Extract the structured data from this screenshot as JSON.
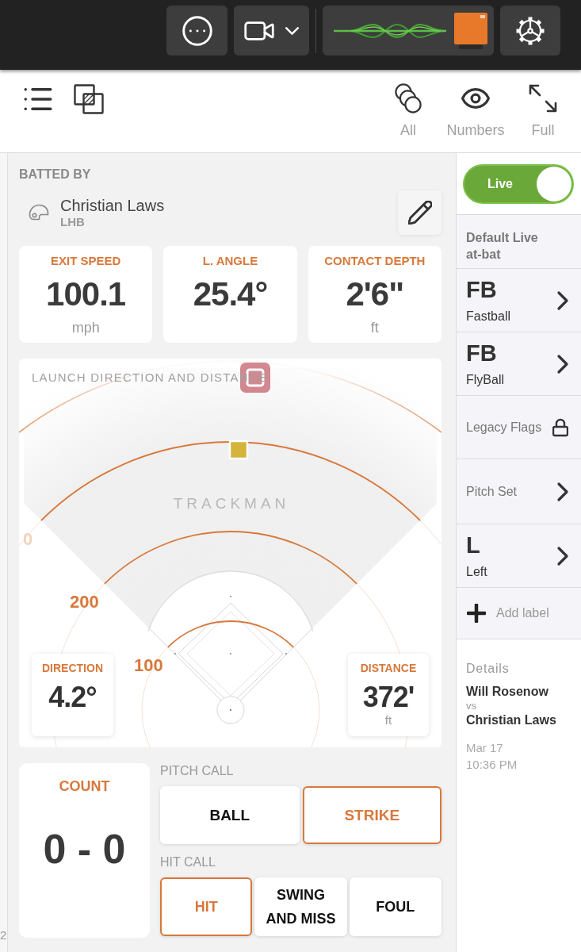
{
  "toolbar": {
    "view_options": [
      {
        "kind": "all",
        "label": "All"
      },
      {
        "kind": "numbers",
        "label": "Numbers"
      },
      {
        "kind": "full",
        "label": "Full"
      }
    ]
  },
  "batted_by": {
    "label": "BATTED BY",
    "name": "Christian Laws",
    "hand": "LHB"
  },
  "metrics": [
    {
      "label": "EXIT SPEED",
      "value": "100.1",
      "unit": "mph"
    },
    {
      "label": "L. ANGLE",
      "value": "25.4°"
    },
    {
      "label": "CONTACT DEPTH",
      "value": "2'6\"",
      "unit": "ft"
    }
  ],
  "launch_chart": {
    "title": "LAUNCH DIRECTION AND DISTANCE",
    "logo": "TRACKMAN",
    "distance_labels": [
      {
        "text": "100",
        "faded": false
      },
      {
        "text": "200",
        "faded": false
      },
      {
        "text": "0",
        "faded": true
      }
    ],
    "direction": {
      "label": "DIRECTION",
      "value": "4.2°"
    },
    "distance": {
      "label": "DISTANCE",
      "value": "372'",
      "unit": "ft"
    }
  },
  "count": {
    "label": "COUNT",
    "value": "0 - 0"
  },
  "pitch_call": {
    "label": "PITCH CALL",
    "options": [
      {
        "label": "BALL",
        "selected": false
      },
      {
        "label": "STRIKE",
        "selected": true
      }
    ]
  },
  "hit_call": {
    "label": "HIT CALL",
    "options": [
      {
        "label": "HIT",
        "selected": true
      },
      {
        "label": "SWING AND MISS",
        "selected": false
      },
      {
        "label": "FOUL",
        "selected": false
      }
    ]
  },
  "sidebar": {
    "live_toggle": {
      "label": "Live",
      "on": true
    },
    "items": [
      {
        "kind": "header",
        "label": "Default Live at-bat"
      },
      {
        "kind": "tag",
        "code": "FB",
        "label": "Fastball"
      },
      {
        "kind": "tag",
        "code": "FB",
        "label": "FlyBall"
      },
      {
        "kind": "locked",
        "label": "Legacy Flags"
      },
      {
        "kind": "link",
        "label": "Pitch Set"
      },
      {
        "kind": "tag",
        "code": "L",
        "label": "Left"
      },
      {
        "kind": "add",
        "label": "Add label"
      }
    ],
    "details": {
      "label": "Details",
      "pitcher": "Will Rosenow",
      "versus": "vs",
      "batter": "Christian Laws",
      "date": "Mar 17",
      "time": "10:36 PM"
    }
  },
  "left_edge": {
    "text": "2"
  }
}
